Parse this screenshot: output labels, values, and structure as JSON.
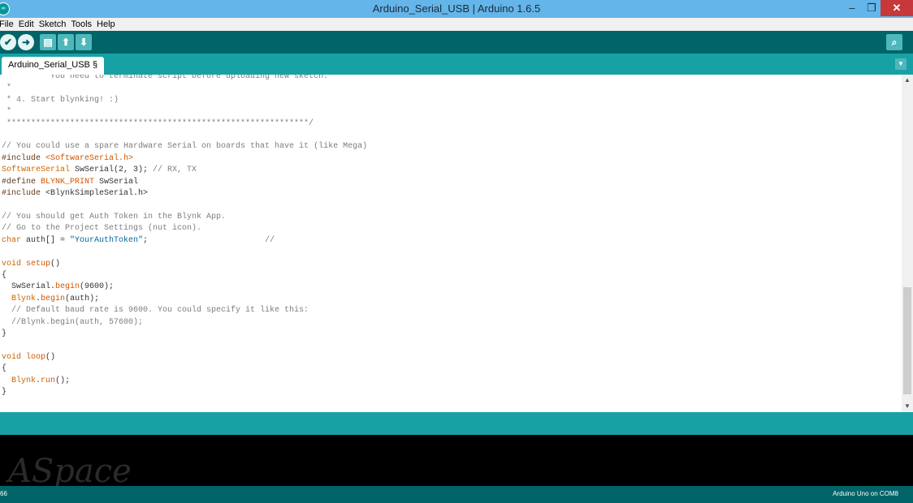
{
  "window": {
    "title": "Arduino_Serial_USB | Arduino 1.6.5",
    "app_icon": "arduino-logo",
    "controls": {
      "minimize": "–",
      "maximize": "❐",
      "close": "✕"
    }
  },
  "menu": [
    "File",
    "Edit",
    "Sketch",
    "Tools",
    "Help"
  ],
  "toolbar": {
    "verify_icon": "✔",
    "upload_icon": "➜",
    "new_icon": "▤",
    "open_icon": "⬆",
    "save_icon": "⬇",
    "serial_monitor_icon": "⌕"
  },
  "tab": {
    "label": "Arduino_Serial_USB §",
    "menu_icon": "▼"
  },
  "editor": {
    "lines": [
      [
        {
          "t": " *        You need to terminate script before uploading new sketch.",
          "c": "cm"
        }
      ],
      [
        {
          "t": " *",
          "c": "cm"
        }
      ],
      [
        {
          "t": " * 4. Start blynking! :)",
          "c": "cm"
        }
      ],
      [
        {
          "t": " *",
          "c": "cm"
        }
      ],
      [
        {
          "t": " **************************************************************/",
          "c": "cm"
        }
      ],
      [],
      [
        {
          "t": "// You could use a spare Hardware Serial on boards that have it (like Mega)",
          "c": "cm"
        }
      ],
      [
        {
          "t": "#include ",
          "c": "pp"
        },
        {
          "t": "<SoftwareSerial.h>",
          "c": "fn"
        }
      ],
      [
        {
          "t": "SoftwareSerial",
          "c": "kw"
        },
        {
          "t": " SwSerial(2, 3); "
        },
        {
          "t": "// RX, TX",
          "c": "cm"
        }
      ],
      [
        {
          "t": "#define ",
          "c": "pp"
        },
        {
          "t": "BLYNK_PRINT",
          "c": "fn"
        },
        {
          "t": " SwSerial"
        }
      ],
      [
        {
          "t": "#include ",
          "c": "pp"
        },
        {
          "t": "<BlynkSimpleSerial.h>"
        }
      ],
      [],
      [
        {
          "t": "// You should get Auth Token in the Blynk App.",
          "c": "cm"
        }
      ],
      [
        {
          "t": "// Go to the Project Settings (nut icon).",
          "c": "cm"
        }
      ],
      [
        {
          "t": "char",
          "c": "kw"
        },
        {
          "t": " auth[] = "
        },
        {
          "t": "\"YourAuthToken\"",
          "c": "str"
        },
        {
          "t": ";                        "
        },
        {
          "t": "//",
          "c": "cm"
        }
      ],
      [],
      [
        {
          "t": "void",
          "c": "kw"
        },
        {
          "t": " "
        },
        {
          "t": "setup",
          "c": "fn"
        },
        {
          "t": "()"
        }
      ],
      [
        {
          "t": "{"
        }
      ],
      [
        {
          "t": "  SwSerial."
        },
        {
          "t": "begin",
          "c": "fn"
        },
        {
          "t": "(9600);"
        }
      ],
      [
        {
          "t": "  "
        },
        {
          "t": "Blynk",
          "c": "kw"
        },
        {
          "t": "."
        },
        {
          "t": "begin",
          "c": "fn"
        },
        {
          "t": "(auth);"
        }
      ],
      [
        {
          "t": "  // Default baud rate is 9600. You could specify it like this:",
          "c": "cm"
        }
      ],
      [
        {
          "t": "  //Blynk.begin(auth, 57600);",
          "c": "cm"
        }
      ],
      [
        {
          "t": "}"
        }
      ],
      [],
      [
        {
          "t": "void",
          "c": "kw"
        },
        {
          "t": " "
        },
        {
          "t": "loop",
          "c": "fn"
        },
        {
          "t": "()"
        }
      ],
      [
        {
          "t": "{"
        }
      ],
      [
        {
          "t": "  "
        },
        {
          "t": "Blynk",
          "c": "kw"
        },
        {
          "t": "."
        },
        {
          "t": "run",
          "c": "fn"
        },
        {
          "t": "();"
        }
      ],
      [
        {
          "t": "}"
        }
      ]
    ]
  },
  "watermark": "ASpace",
  "footer": {
    "line_number": "66",
    "board": "Arduino Uno on COM8"
  }
}
